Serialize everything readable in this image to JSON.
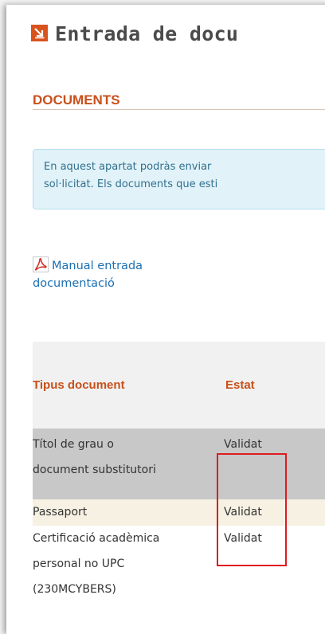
{
  "page": {
    "title": "Entrada de docu"
  },
  "section": {
    "title": "DOCUMENTS"
  },
  "info": {
    "line1": "En aquest apartat podràs enviar",
    "line2": "sol·licitat. Els documents que esti"
  },
  "manual": {
    "line1": "Manual entrada",
    "line2": "documentació"
  },
  "table": {
    "headers": {
      "type": "Tipus document",
      "status": "Estat"
    },
    "rows": [
      {
        "doc_lines": [
          "Títol de grau o",
          "document substitutori"
        ],
        "status": "Validat"
      },
      {
        "doc_lines": [
          "Passaport"
        ],
        "status": "Validat"
      },
      {
        "doc_lines": [
          "Certificació acadèmica",
          "personal no UPC",
          "(230MCYBERS)"
        ],
        "status": "Validat"
      }
    ]
  },
  "colors": {
    "accent": "#c8501a",
    "title_icon": "#d9531e",
    "info_bg": "#e1f2f8",
    "info_text": "#31708f",
    "link": "#1a6fb3",
    "row_selected": "#c8c8c8",
    "row_alt": "#f6f1e3",
    "highlight": "#e01b22"
  }
}
